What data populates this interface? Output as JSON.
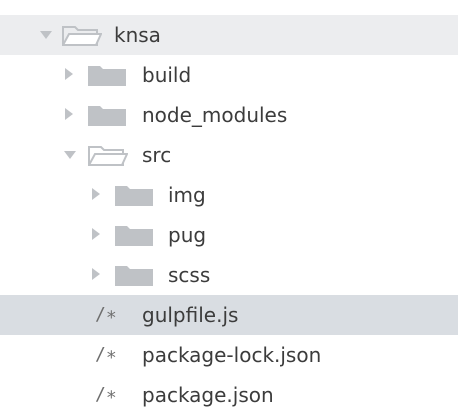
{
  "tree": {
    "root": {
      "label": "knsa",
      "expanded": true,
      "icon": "folder-open-icon"
    },
    "items": [
      {
        "label": "build",
        "type": "folder",
        "expanded": false,
        "icon": "folder-icon"
      },
      {
        "label": "node_modules",
        "type": "folder",
        "expanded": false,
        "icon": "folder-icon"
      },
      {
        "label": "src",
        "type": "folder",
        "expanded": true,
        "icon": "folder-open-icon",
        "children": [
          {
            "label": "img",
            "type": "folder",
            "expanded": false,
            "icon": "folder-icon"
          },
          {
            "label": "pug",
            "type": "folder",
            "expanded": false,
            "icon": "folder-icon"
          },
          {
            "label": "scss",
            "type": "folder",
            "expanded": false,
            "icon": "folder-icon"
          }
        ]
      },
      {
        "label": "gulpfile.js",
        "type": "file",
        "selected": true,
        "icon": "js-file-icon",
        "mark": "/∗"
      },
      {
        "label": "package-lock.json",
        "type": "file",
        "icon": "json-file-icon",
        "mark": "/∗"
      },
      {
        "label": "package.json",
        "type": "file",
        "icon": "json-file-icon",
        "mark": "/∗"
      }
    ]
  },
  "colors": {
    "folder": "#bfc2c6",
    "arrow": "#bfc2c6",
    "text": "#3c3c3c",
    "selected_row": "#d9dde2",
    "root_row": "#ecedef"
  }
}
